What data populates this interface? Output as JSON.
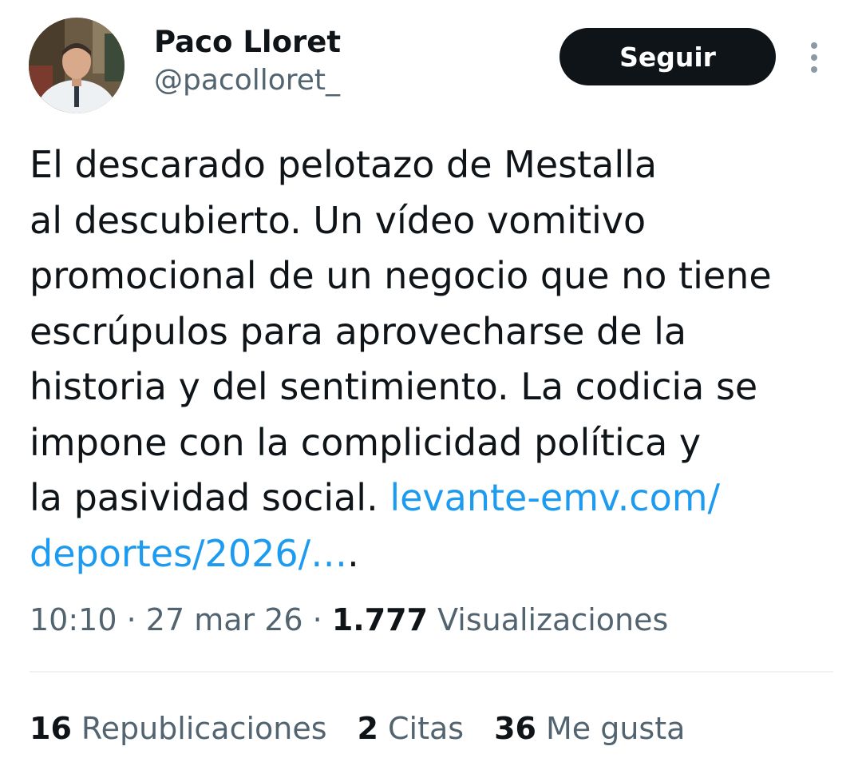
{
  "author": {
    "display_name": "Paco Lloret",
    "handle": "@pacolloret_",
    "avatar": "profile-photo"
  },
  "follow_button": {
    "label": "Seguir"
  },
  "more_icon": "more-vertical-icon",
  "tweet": {
    "lines": [
      "El descarado pelotazo de Mestalla",
      "al descubierto. Un vídeo vomitivo",
      "promocional de un negocio que no tiene",
      "escrúpulos para aprovecharse de la",
      "historia y del sentimiento. La codicia se",
      "impone con la complicidad política y",
      "la pasividad social."
    ],
    "link_part1": "levante-emv.com/",
    "link_part2": "deportes/2026/…",
    "link_trailing": "."
  },
  "meta": {
    "time": "10:10",
    "separator": " · ",
    "date": "27 mar 26",
    "views_count": "1.777",
    "views_label": "Visualizaciones"
  },
  "stats": [
    {
      "count": "16",
      "label": "Republicaciones"
    },
    {
      "count": "2",
      "label": "Citas"
    },
    {
      "count": "36",
      "label": "Me gusta"
    }
  ],
  "colors": {
    "text": "#0f1419",
    "secondary": "#536471",
    "link": "#1d9bf0",
    "button_bg": "#0f1419",
    "divider": "#eff3f4"
  }
}
